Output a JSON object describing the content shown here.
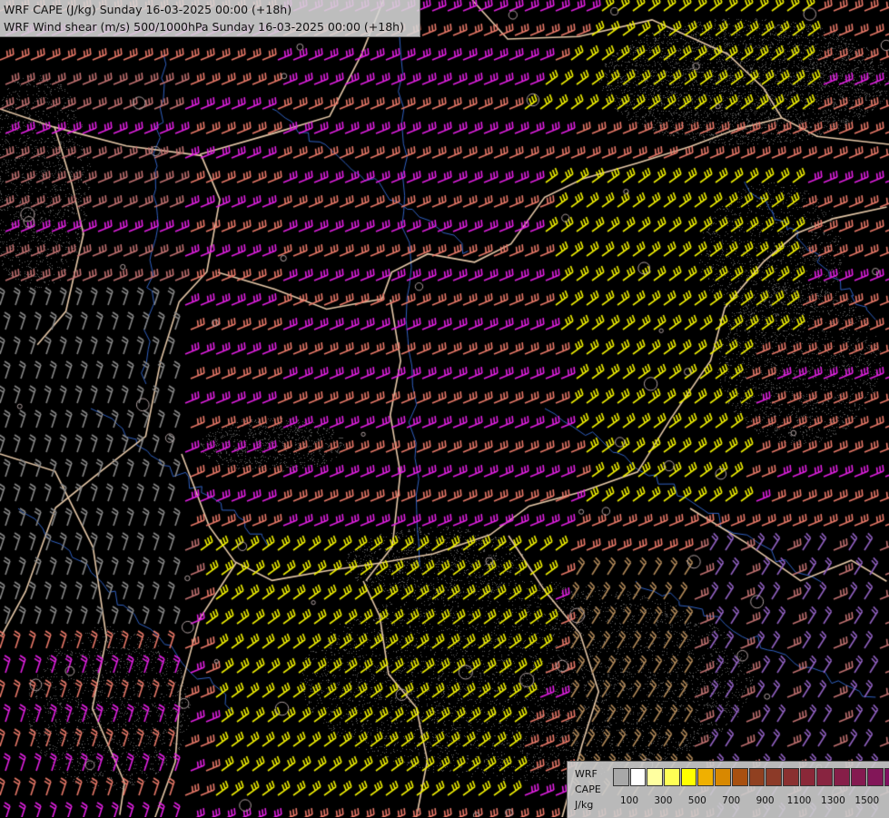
{
  "header": {
    "line1": "WRF CAPE (J/kg) Sunday 16-03-2025 00:00 (+18h)",
    "line2": "WRF Wind shear (m/s) 500/1000hPa Sunday 16-03-2025 00:00 (+18h)"
  },
  "legend": {
    "label1": "WRF",
    "label2": "CAPE",
    "label3": "J/kg",
    "swatch_colors": [
      "#a8a8a8",
      "#ffffff",
      "#ffffa0",
      "#ffff55",
      "#ffff00",
      "#f0b000",
      "#d88800",
      "#a85010",
      "#904020",
      "#8c3a28",
      "#8a3030",
      "#8a2838",
      "#882440",
      "#861e48",
      "#841a50",
      "#821658",
      "#801060",
      "#7a0868"
    ],
    "ticks": [
      "100",
      "300",
      "500",
      "700",
      "900",
      "1100",
      "1300",
      "1500"
    ]
  },
  "map": {
    "barb_colors": {
      "magenta": "#e020e0",
      "salmon": "#e87868",
      "yellow": "#f0f000",
      "pink": "#c07070",
      "gray": "#888888",
      "violet": "#9060c0",
      "tan": "#b08858"
    },
    "border_color": "#e6c8a8",
    "river_color": "#3060c0"
  }
}
